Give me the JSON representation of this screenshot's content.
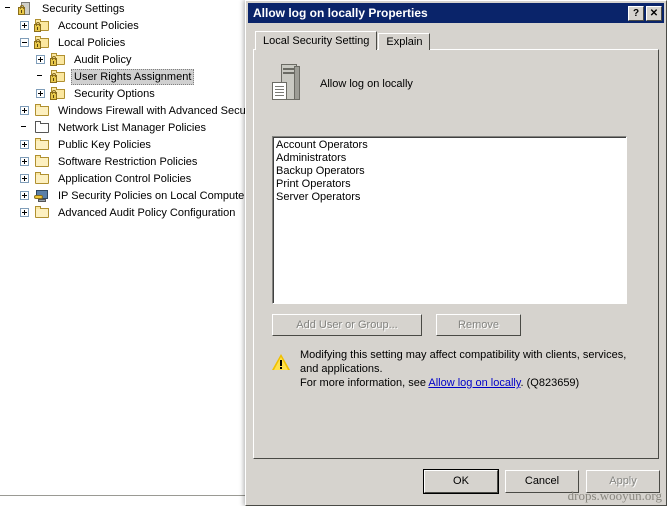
{
  "tree": {
    "items": [
      {
        "label": "Security Settings",
        "indent": 0,
        "expander": "none",
        "icon": "security-settings-icon",
        "selected": false
      },
      {
        "label": "Account Policies",
        "indent": 1,
        "expander": "plus",
        "icon": "policy-folder-icon",
        "selected": false
      },
      {
        "label": "Local Policies",
        "indent": 1,
        "expander": "minus",
        "icon": "policy-folder-icon",
        "selected": false
      },
      {
        "label": "Audit Policy",
        "indent": 2,
        "expander": "plus",
        "icon": "policy-folder-icon",
        "selected": false
      },
      {
        "label": "User Rights Assignment",
        "indent": 2,
        "expander": "none",
        "icon": "policy-folder-icon",
        "selected": true
      },
      {
        "label": "Security Options",
        "indent": 2,
        "expander": "plus",
        "icon": "policy-folder-icon",
        "selected": false
      },
      {
        "label": "Windows Firewall with Advanced Security",
        "indent": 1,
        "expander": "plus",
        "icon": "folder-icon",
        "selected": false
      },
      {
        "label": "Network List Manager Policies",
        "indent": 1,
        "expander": "none",
        "icon": "network-folder-icon",
        "selected": false
      },
      {
        "label": "Public Key Policies",
        "indent": 1,
        "expander": "plus",
        "icon": "folder-icon",
        "selected": false
      },
      {
        "label": "Software Restriction Policies",
        "indent": 1,
        "expander": "plus",
        "icon": "folder-icon",
        "selected": false
      },
      {
        "label": "Application Control Policies",
        "indent": 1,
        "expander": "plus",
        "icon": "folder-icon",
        "selected": false
      },
      {
        "label": "IP Security Policies on Local Computer",
        "indent": 1,
        "expander": "plus",
        "icon": "ip-security-icon",
        "selected": false
      },
      {
        "label": "Advanced Audit Policy Configuration",
        "indent": 1,
        "expander": "plus",
        "icon": "folder-icon",
        "selected": false
      }
    ]
  },
  "dialog": {
    "title": "Allow log on locally Properties",
    "help_button": "?",
    "close_button": "✕",
    "tabs": [
      {
        "label": "Local Security Setting",
        "active": true
      },
      {
        "label": "Explain",
        "active": false
      }
    ],
    "policy_title": "Allow log on locally",
    "list_items": [
      "Account Operators",
      "Administrators",
      "Backup Operators",
      "Print Operators",
      "Server Operators"
    ],
    "add_button": "Add User or Group...",
    "remove_button": "Remove",
    "add_button_enabled": false,
    "remove_button_enabled": false,
    "warning": {
      "line1": "Modifying this setting may affect compatibility with clients, services,",
      "line2": "and applications.",
      "line3_prefix": "For more information, see ",
      "link_text": "Allow log on locally",
      "line3_suffix": ". (Q823659)"
    },
    "ok_button": "OK",
    "cancel_button": "Cancel",
    "apply_button": "Apply",
    "apply_button_enabled": false
  },
  "watermark": "drops.wooyun.org",
  "colors": {
    "titlebar": "#0a246a",
    "dialog_face": "#d6d3ce",
    "listbox_bg": "#ffffff",
    "link": "#0000c8",
    "warning_triangle": "#f0c000",
    "selection": "#d0d0d0"
  }
}
